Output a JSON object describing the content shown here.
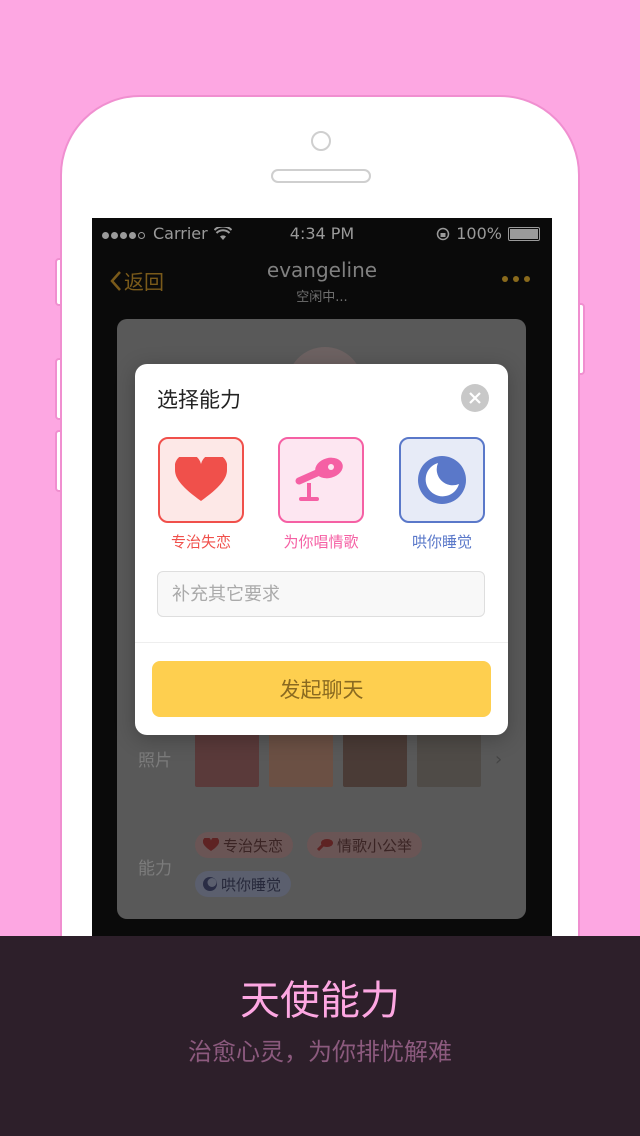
{
  "colors": {
    "background": "#fda7e2",
    "dialog_button": "#fecf4f",
    "love_red": "#f0504b",
    "song_pink": "#f560a4",
    "sleep_blue": "#5a78c9",
    "feature_title": "#fda7e2",
    "feature_sub": "#8c5a7e",
    "bottom_bar": "#2d1f2a"
  },
  "status_bar": {
    "carrier": "Carrier",
    "time": "4:34 PM",
    "battery": "100%"
  },
  "nav": {
    "back_label": "返回",
    "title": "evangeline",
    "subtitle": "空闲中..."
  },
  "profile": {
    "photos_label": "照片",
    "abilities_label": "能力",
    "tags": [
      {
        "label": "专治失恋",
        "icon": "heart-icon"
      },
      {
        "label": "情歌小公举",
        "icon": "microphone-icon"
      },
      {
        "label": "哄你睡觉",
        "icon": "moon-icon"
      }
    ]
  },
  "dialog": {
    "title": "选择能力",
    "abilities": [
      {
        "label": "专治失恋",
        "icon": "heart-icon",
        "color": "#f0504b"
      },
      {
        "label": "为你唱情歌",
        "icon": "microphone-icon",
        "color": "#f560a4"
      },
      {
        "label": "哄你睡觉",
        "icon": "moon-icon",
        "color": "#5a78c9"
      }
    ],
    "input_placeholder": "补充其它要求",
    "start_button": "发起聊天"
  },
  "feature": {
    "title": "天使能力",
    "subtitle": "治愈心灵，为你排忧解难"
  }
}
